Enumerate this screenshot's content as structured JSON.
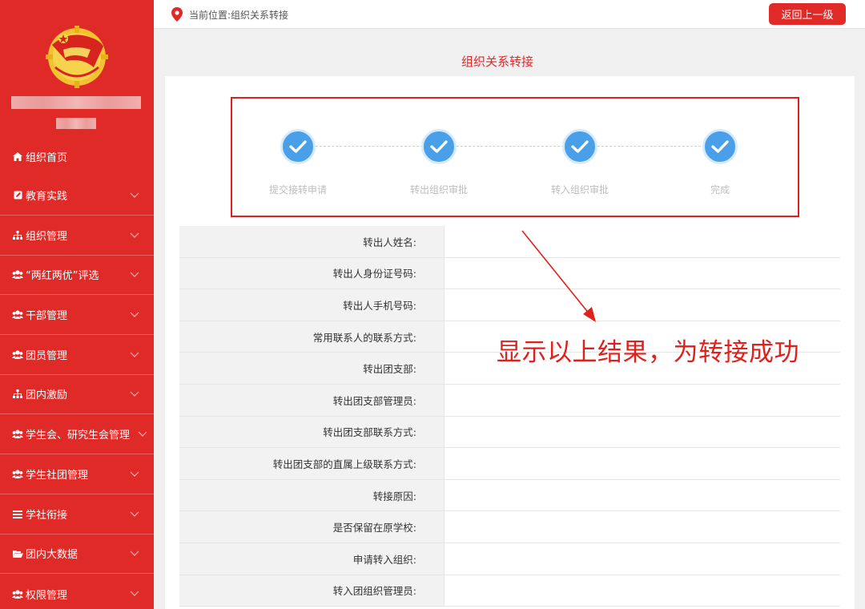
{
  "sidebar": {
    "items": [
      {
        "label": "组织首页",
        "icon": "home-icon"
      },
      {
        "label": "教育实践",
        "icon": "edit-icon"
      },
      {
        "label": "组织管理",
        "icon": "sitemap-icon"
      },
      {
        "label": "“两红两优”评选",
        "icon": "users-icon"
      },
      {
        "label": "干部管理",
        "icon": "users-icon"
      },
      {
        "label": "团员管理",
        "icon": "users-icon"
      },
      {
        "label": "团内激励",
        "icon": "sitemap-icon"
      },
      {
        "label": "学生会、研究生会管理",
        "icon": "users-icon"
      },
      {
        "label": "学生社团管理",
        "icon": "users-icon"
      },
      {
        "label": "学社衔接",
        "icon": "bars-icon"
      },
      {
        "label": "团内大数据",
        "icon": "folder-open-icon"
      },
      {
        "label": "权限管理",
        "icon": "users-icon"
      }
    ]
  },
  "topbar": {
    "location": "当前位置:组织关系转接",
    "back_label": "返回上一级"
  },
  "page": {
    "title": "组织关系转接"
  },
  "steps": [
    {
      "label": "提交接转申请",
      "done": true
    },
    {
      "label": "转出组织审批",
      "done": true
    },
    {
      "label": "转入组织审批",
      "done": true
    },
    {
      "label": "完成",
      "done": true
    }
  ],
  "form": {
    "rows": [
      {
        "label": "转出人姓名:",
        "value": ""
      },
      {
        "label": "转出人身份证号码:",
        "value": ""
      },
      {
        "label": "转出人手机号码:",
        "value": ""
      },
      {
        "label": "常用联系人的联系方式:",
        "value": ""
      },
      {
        "label": "转出团支部:",
        "value": ""
      },
      {
        "label": "转出团支部管理员:",
        "value": ""
      },
      {
        "label": "转出团支部联系方式:",
        "value": ""
      },
      {
        "label": "转出团支部的直属上级联系方式:",
        "value": ""
      },
      {
        "label": "转接原因:",
        "value": ""
      },
      {
        "label": "是否保留在原学校:",
        "value": ""
      },
      {
        "label": "申请转入组织:",
        "value": ""
      },
      {
        "label": "转入团组织管理员:",
        "value": ""
      }
    ]
  },
  "annotation": {
    "text": "显示以上结果，为转接成功"
  },
  "colors": {
    "primary": "#df2a28",
    "step_blue": "#4aa0e8",
    "annotation_red": "#e0201c"
  }
}
